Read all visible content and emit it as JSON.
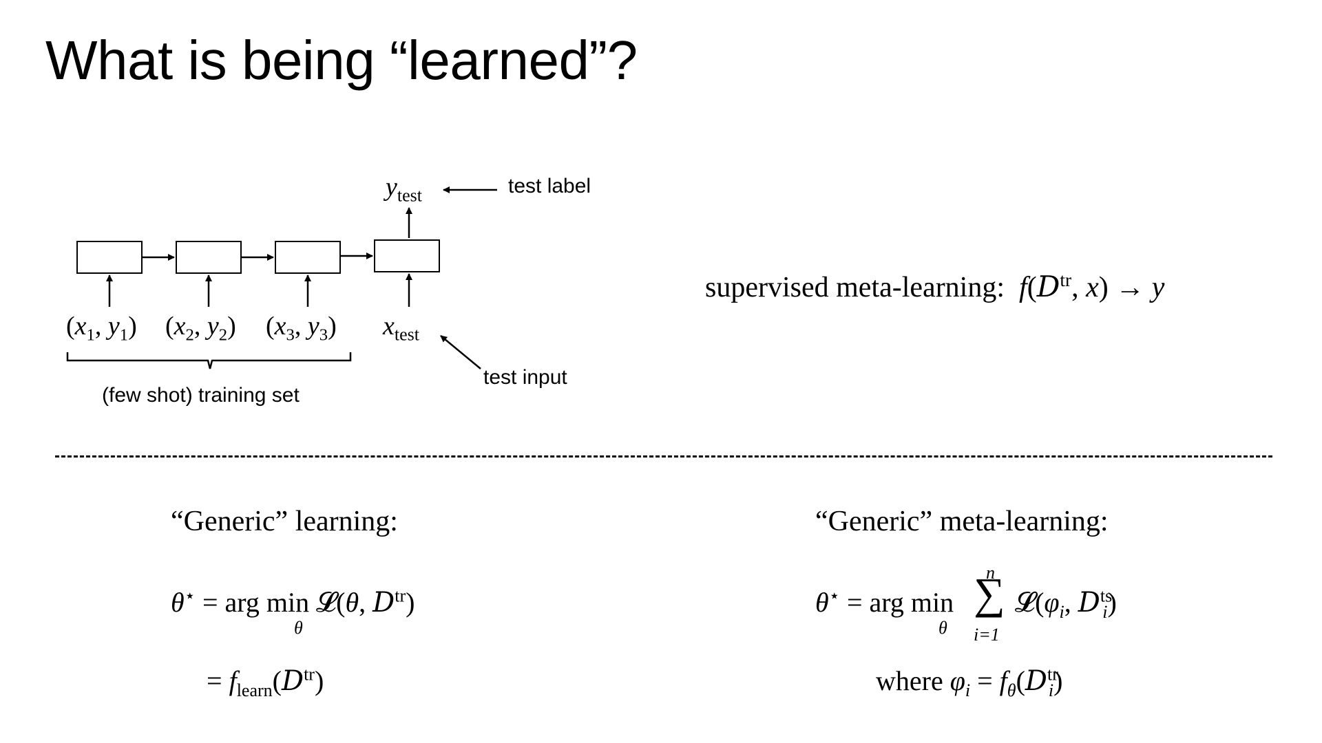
{
  "slide": {
    "title": "What is being “learned”?"
  },
  "diagram": {
    "y_test": "test",
    "test_label": "test label",
    "test_input": "test input",
    "training_set": "(few shot) training set",
    "pairs": [
      "1",
      "2",
      "3"
    ],
    "x_test": "test"
  },
  "supervised": {
    "text": "supervised meta-learning:",
    "sup": "tr"
  },
  "generic_learning": {
    "heading": "“Generic” learning:",
    "sup": "tr",
    "f_sub": "learn"
  },
  "generic_meta": {
    "heading": "“Generic” meta-learning:",
    "sum_top": "n",
    "sum_bottom": "i=1",
    "sup_ts": "ts",
    "sup_tr": "tr",
    "where": "where"
  }
}
